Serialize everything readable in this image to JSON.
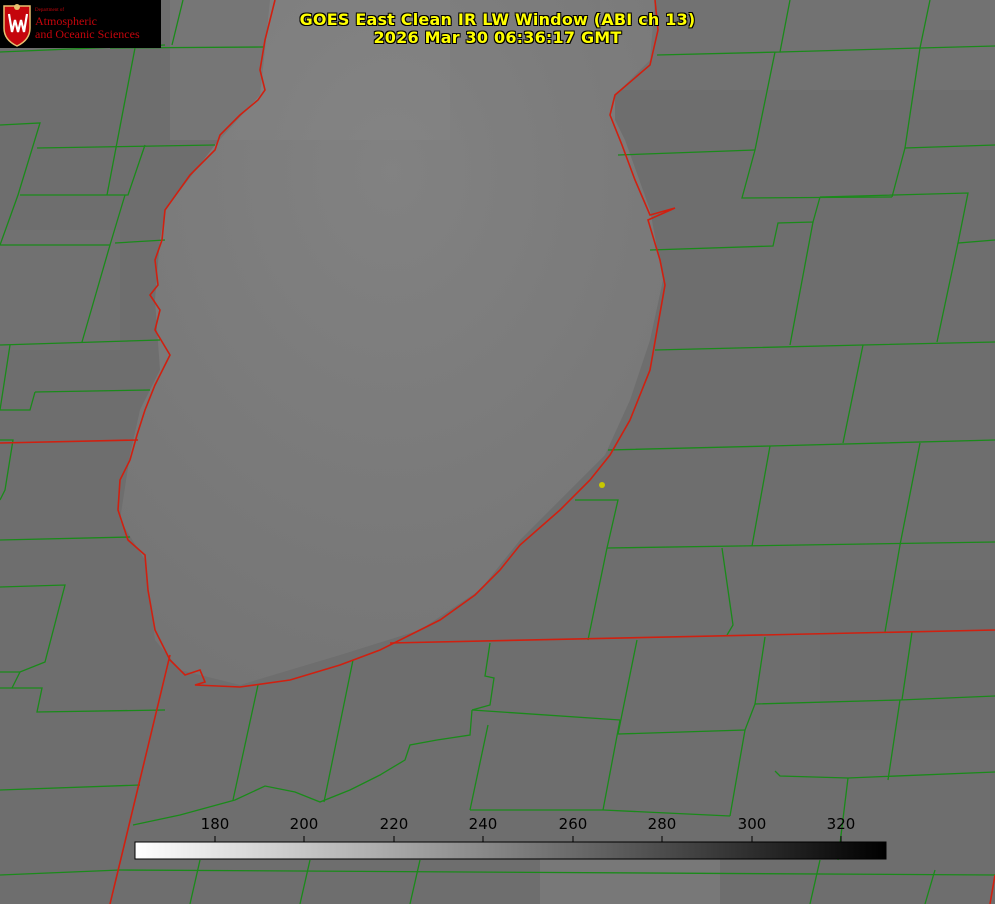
{
  "title": {
    "line1": "GOES East Clean IR LW Window (ABI ch 13)",
    "line2": "2026 Mar 30 06:36:17 GMT"
  },
  "logo": {
    "dept": "Department of",
    "line1": "Atmospheric",
    "line2": "and Oceanic Sciences"
  },
  "colorbar": {
    "ticks": [
      "180",
      "200",
      "220",
      "240",
      "260",
      "280",
      "300",
      "320"
    ],
    "range": [
      162,
      332
    ],
    "gradient": "white-to-black"
  },
  "colors": {
    "title": "#ffff00",
    "county_lines": "#1a8a1a",
    "state_lines": "#d02010",
    "station_marker": "#c8c800",
    "background": "#6f6f6f"
  }
}
